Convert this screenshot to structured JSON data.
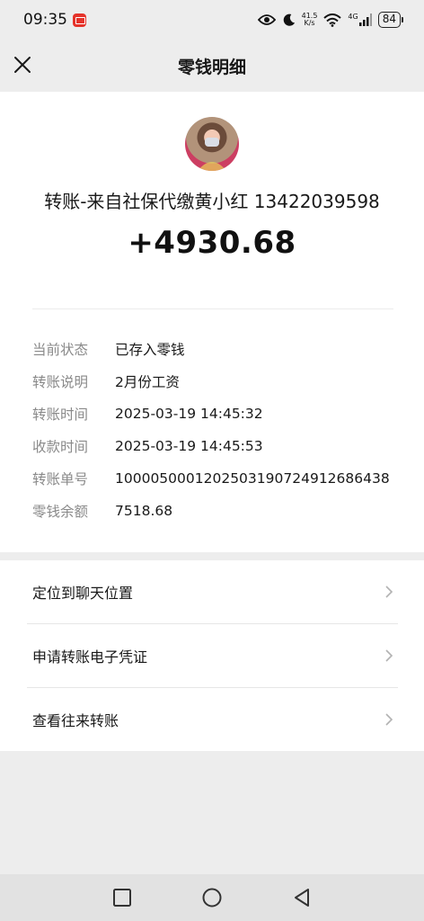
{
  "status_bar": {
    "time": "09:35",
    "net_speed_value": "41.5",
    "net_speed_unit": "K/s",
    "network_type": "4G",
    "battery": "84"
  },
  "header": {
    "title": "零钱明细",
    "close_icon": "close-icon"
  },
  "transfer": {
    "from": "转账-来自社保代缴黄小红 13422039598",
    "amount": "+4930.68"
  },
  "details": [
    {
      "key": "当前状态",
      "value": "已存入零钱"
    },
    {
      "key": "转账说明",
      "value": "2月份工资"
    },
    {
      "key": "转账时间",
      "value": "2025-03-19 14:45:32"
    },
    {
      "key": "收款时间",
      "value": "2025-03-19 14:45:53"
    },
    {
      "key": "转账单号",
      "value": "1000050001202503190724912686438"
    },
    {
      "key": "零钱余额",
      "value": "7518.68"
    }
  ],
  "menu": [
    {
      "label": "定位到聊天位置"
    },
    {
      "label": "申请转账电子凭证"
    },
    {
      "label": "查看往来转账"
    }
  ],
  "colors": {
    "background": "#ededed",
    "card": "#ffffff",
    "text": "#191919",
    "muted": "#8a8a8a"
  }
}
